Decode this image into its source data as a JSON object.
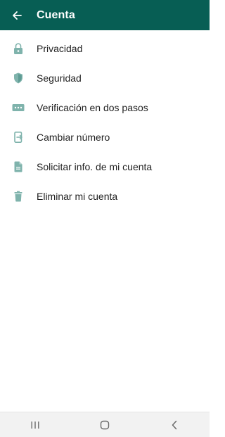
{
  "app_bar": {
    "title": "Cuenta",
    "back_icon": "arrow-back-icon",
    "color": "#075e54"
  },
  "menu": {
    "icon_color": "#7fb3ac",
    "items": [
      {
        "label": "Privacidad",
        "icon": "lock-icon"
      },
      {
        "label": "Seguridad",
        "icon": "shield-icon"
      },
      {
        "label": "Verificación en dos pasos",
        "icon": "dots-icon"
      },
      {
        "label": "Cambiar número",
        "icon": "phone-change-icon"
      },
      {
        "label": "Solicitar info. de mi cuenta",
        "icon": "document-icon"
      },
      {
        "label": "Eliminar mi cuenta",
        "icon": "trash-icon"
      }
    ]
  },
  "nav_bar": {
    "buttons": [
      "recent-apps-icon",
      "home-icon",
      "back-icon"
    ]
  }
}
